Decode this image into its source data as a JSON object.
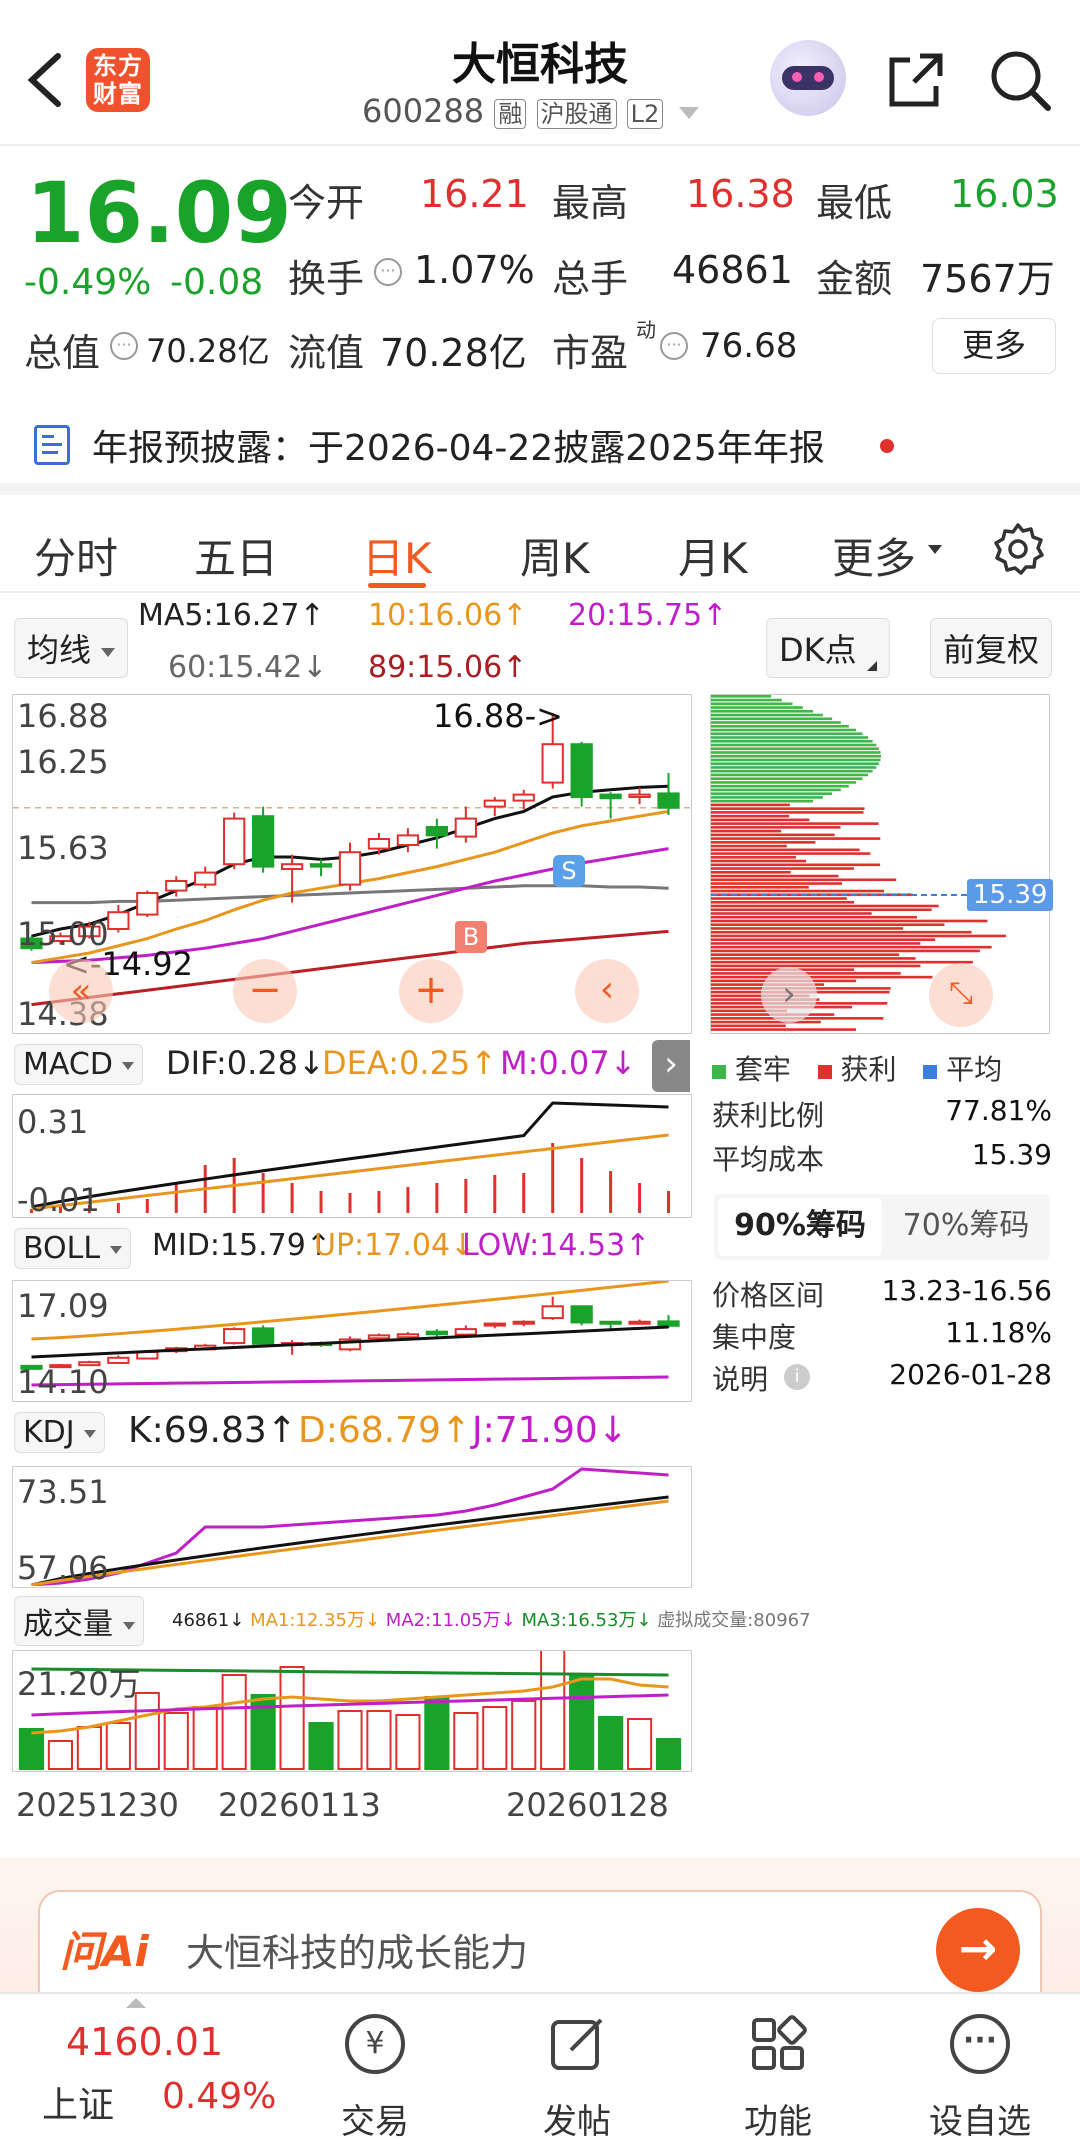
{
  "header": {
    "title": "大恒科技",
    "code": "600288",
    "badges": [
      "融",
      "沪股通",
      "L2"
    ],
    "app_logo_text": "东方财富"
  },
  "quote": {
    "price": "16.09",
    "change_pct": "-0.49%",
    "change_abs": "-0.08",
    "open_label": "今开",
    "open": "16.21",
    "high_label": "最高",
    "high": "16.38",
    "low_label": "最低",
    "low": "16.03",
    "turnover_label": "换手",
    "turnover": "1.07%",
    "vol_label": "总手",
    "vol": "46861",
    "amount_label": "金额",
    "amount": "7567万",
    "mcap_label": "总值",
    "mcap": "70.28亿",
    "float_label": "流值",
    "float": "70.28亿",
    "pe_label": "市盈",
    "pe_sup": "动",
    "pe": "76.68",
    "more_button": "更多"
  },
  "notice": {
    "text": "年报预披露：于2026-04-22披露2025年年报"
  },
  "tabs": [
    "分时",
    "五日",
    "日K",
    "周K",
    "月K",
    "更多"
  ],
  "active_tab": "日K",
  "ma_bar": {
    "selector": "均线",
    "ma5": "MA5:16.27↑",
    "ma10": "10:16.06↑",
    "ma20": "20:15.75↑",
    "ma60": "60:15.42↓",
    "ma89": "89:15.06↑",
    "dk_button": "DK点",
    "adjust_button": "前复权"
  },
  "kline": {
    "y_labels": [
      "16.88",
      "16.25",
      "15.63",
      "15.00",
      "14.38"
    ],
    "high_marker": "16.88->",
    "low_marker": "<-14.92",
    "buy_marker": "B",
    "sell_marker": "S"
  },
  "chips": {
    "avg_tag": "15.39",
    "legend": [
      "套牢",
      "获利",
      "平均"
    ],
    "profit_ratio_label": "获利比例",
    "profit_ratio": "77.81%",
    "avg_cost_label": "平均成本",
    "avg_cost": "15.39",
    "tab90": "90%筹码",
    "tab70": "70%筹码",
    "range_label": "价格区间",
    "range": "13.23-16.56",
    "concentration_label": "集中度",
    "concentration": "11.18%",
    "note_label": "说明",
    "note": "2026-01-28"
  },
  "macd": {
    "name": "MACD",
    "dif": "DIF:0.28↓",
    "dea": "DEA:0.25↑",
    "m": "M:0.07↓",
    "y_top": "0.31",
    "y_bot": "-0.01"
  },
  "boll": {
    "name": "BOLL",
    "mid": "MID:15.79↑",
    "up": "UP:17.04↓",
    "low": "LOW:14.53↑",
    "y_top": "17.09",
    "y_bot": "14.10"
  },
  "kdj": {
    "name": "KDJ",
    "k": "K:69.83↑",
    "d": "D:68.79↑",
    "j": "J:71.90↓",
    "y_top": "73.51",
    "y_bot": "57.06"
  },
  "volume": {
    "name": "成交量",
    "vol": "46861↓",
    "ma1": "MA1:12.35万↓",
    "ma2": "MA2:11.05万↓",
    "ma3": "MA3:16.53万↓",
    "virtual": "虚拟成交量:80967",
    "y_top": "21.20万"
  },
  "dates": [
    "20251230",
    "20260113",
    "20260128"
  ],
  "ai_box": {
    "logo": "问Ai",
    "prompt": "大恒科技的成长能力"
  },
  "index": {
    "value": "4160.01",
    "name": "上证",
    "pct": "0.49%"
  },
  "nav": [
    "交易",
    "发帖",
    "功能",
    "设自选"
  ],
  "colors": {
    "up": "#e0302e",
    "down": "#1aa32a",
    "accent": "#f35a1f",
    "ma10": "#e8961e",
    "ma20": "#c01fc8"
  },
  "chart_data": {
    "type": "candlestick",
    "candles": [
      {
        "o": 15.0,
        "c": 14.92,
        "h": 15.02,
        "l": 14.9
      },
      {
        "o": 14.98,
        "c": 15.02,
        "h": 15.05,
        "l": 14.95
      },
      {
        "o": 15.02,
        "c": 15.1,
        "h": 15.14,
        "l": 15.0
      },
      {
        "o": 15.08,
        "c": 15.22,
        "h": 15.28,
        "l": 15.05
      },
      {
        "o": 15.2,
        "c": 15.38,
        "h": 15.4,
        "l": 15.18
      },
      {
        "o": 15.4,
        "c": 15.48,
        "h": 15.52,
        "l": 15.35
      },
      {
        "o": 15.45,
        "c": 15.55,
        "h": 15.6,
        "l": 15.42
      },
      {
        "o": 15.62,
        "c": 16.0,
        "h": 16.05,
        "l": 15.58
      },
      {
        "o": 16.02,
        "c": 15.6,
        "h": 16.1,
        "l": 15.55
      },
      {
        "o": 15.58,
        "c": 15.62,
        "h": 15.7,
        "l": 15.3
      },
      {
        "o": 15.62,
        "c": 15.6,
        "h": 15.66,
        "l": 15.52
      },
      {
        "o": 15.45,
        "c": 15.72,
        "h": 15.8,
        "l": 15.4
      },
      {
        "o": 15.75,
        "c": 15.83,
        "h": 15.88,
        "l": 15.7
      },
      {
        "o": 15.78,
        "c": 15.86,
        "h": 15.92,
        "l": 15.72
      },
      {
        "o": 15.93,
        "c": 15.86,
        "h": 16.0,
        "l": 15.75
      },
      {
        "o": 15.85,
        "c": 16.0,
        "h": 16.1,
        "l": 15.8
      },
      {
        "o": 16.1,
        "c": 16.15,
        "h": 16.18,
        "l": 16.02
      },
      {
        "o": 16.15,
        "c": 16.2,
        "h": 16.24,
        "l": 16.08
      },
      {
        "o": 16.3,
        "c": 16.62,
        "h": 16.88,
        "l": 16.25
      },
      {
        "o": 16.62,
        "c": 16.18,
        "h": 16.64,
        "l": 16.1
      },
      {
        "o": 16.2,
        "c": 16.17,
        "h": 16.22,
        "l": 16.0
      },
      {
        "o": 16.18,
        "c": 16.2,
        "h": 16.26,
        "l": 16.12
      },
      {
        "o": 16.21,
        "c": 16.09,
        "h": 16.38,
        "l": 16.03
      }
    ],
    "ma5": [
      15.02,
      15.08,
      15.12,
      15.2,
      15.3,
      15.4,
      15.5,
      15.62,
      15.68,
      15.68,
      15.66,
      15.68,
      15.72,
      15.78,
      15.84,
      15.92,
      16.0,
      16.06,
      16.18,
      16.22,
      16.24,
      16.26,
      16.27
    ],
    "ma10": [
      14.8,
      14.84,
      14.88,
      14.94,
      15.0,
      15.08,
      15.15,
      15.24,
      15.32,
      15.38,
      15.42,
      15.46,
      15.5,
      15.55,
      15.6,
      15.66,
      15.72,
      15.8,
      15.88,
      15.94,
      15.98,
      16.02,
      16.06
    ],
    "ma20": [
      14.8,
      14.81,
      14.82,
      14.84,
      14.86,
      14.89,
      14.92,
      14.96,
      15.0,
      15.06,
      15.12,
      15.18,
      15.24,
      15.3,
      15.36,
      15.42,
      15.48,
      15.53,
      15.58,
      15.63,
      15.67,
      15.71,
      15.75
    ],
    "ma60": [
      15.3,
      15.3,
      15.3,
      15.31,
      15.31,
      15.32,
      15.33,
      15.34,
      15.35,
      15.36,
      15.37,
      15.38,
      15.39,
      15.4,
      15.41,
      15.42,
      15.43,
      15.44,
      15.44,
      15.44,
      15.43,
      15.43,
      15.42
    ],
    "ma89": [
      14.45,
      14.48,
      14.51,
      14.54,
      14.57,
      14.6,
      14.63,
      14.66,
      14.69,
      14.72,
      14.75,
      14.78,
      14.81,
      14.84,
      14.87,
      14.9,
      14.93,
      14.96,
      14.98,
      15.0,
      15.02,
      15.04,
      15.06
    ],
    "ylim": [
      14.38,
      16.88
    ]
  }
}
